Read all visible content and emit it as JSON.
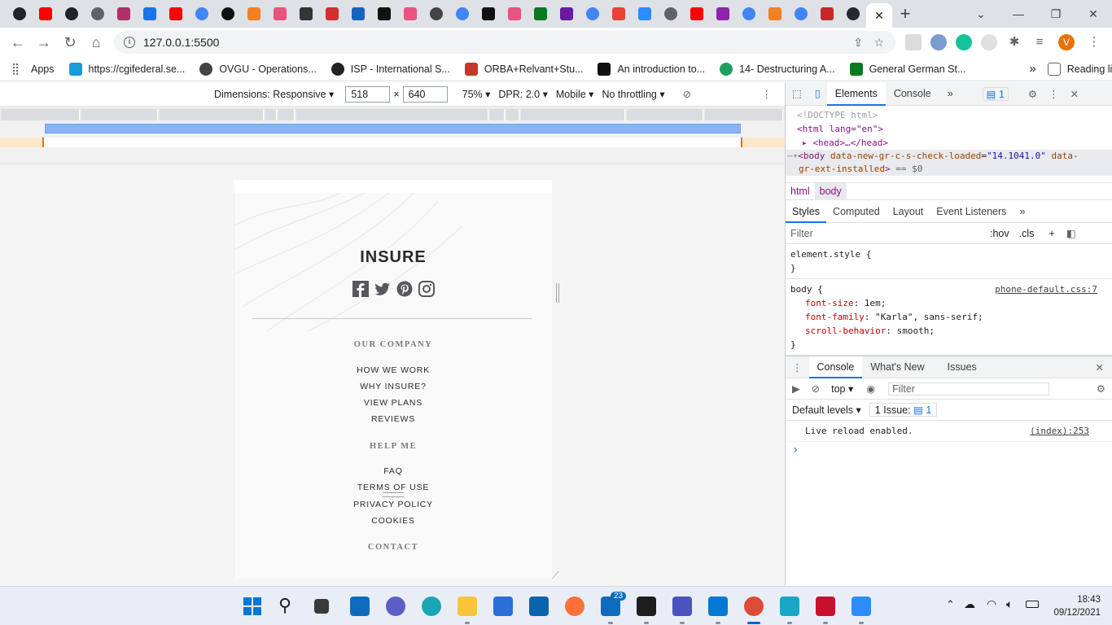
{
  "browser": {
    "url": "127.0.0.1:5500",
    "profile_initial": "V",
    "reading_list": "Reading list"
  },
  "bookmarks": [
    {
      "label": "Apps",
      "color": "#5f6368"
    },
    {
      "label": "https://cgifederal.se...",
      "color": "#1a9bd7"
    },
    {
      "label": "OVGU - Operations...",
      "color": "#444444"
    },
    {
      "label": "ISP - International S...",
      "color": "#222222"
    },
    {
      "label": "ORBA+Relvant+Stu...",
      "color": "#c0392b"
    },
    {
      "label": "An introduction to...",
      "color": "#111111"
    },
    {
      "label": "14- Destructuring A...",
      "color": "#20a060"
    },
    {
      "label": "General German St...",
      "color": "#0a7a20"
    }
  ],
  "devtoolbar": {
    "dimensions": "Dimensions: Responsive",
    "width": "518",
    "times": "×",
    "height": "640",
    "zoom": "75%",
    "dpr": "DPR: 2.0",
    "device_type": "Mobile",
    "throttling": "No throttling"
  },
  "site": {
    "logo": "INSURE",
    "sections": [
      {
        "heading": "OUR COMPANY",
        "links": [
          "HOW WE WORK",
          "WHY INSURE?",
          "VIEW PLANS",
          "REVIEWS"
        ]
      },
      {
        "heading": "HELP ME",
        "links": [
          "FAQ",
          "TERMS OF USE",
          "PRIVACY POLICY",
          "COOKIES"
        ]
      },
      {
        "heading": "CONTACT",
        "links": []
      }
    ]
  },
  "devtools": {
    "tabs": [
      "Elements",
      "Console"
    ],
    "issue_count": "1",
    "dom": {
      "doctype": "<!DOCTYPE html>",
      "html_open": "<html lang=\"en\">",
      "head": "<head>…</head>",
      "body_attr_1_name": "data-new-gr-c-s-check-loaded",
      "body_attr_1_value": "\"14.1041.0\"",
      "body_attr_2_name": "data-gr-ext-installed",
      "body_suffix": "== $0"
    },
    "breadcrumbs": [
      "html",
      "body"
    ],
    "style_tabs": [
      "Styles",
      "Computed",
      "Layout",
      "Event Listeners"
    ],
    "filter_placeholder": "Filter",
    "hov": ":hov",
    "cls": ".cls",
    "element_style": "element.style {",
    "rule_selector": "body {",
    "rule_source": "phone-default.css:7",
    "rule_props": [
      {
        "name": "font-size",
        "value": "1em;"
      },
      {
        "name": "font-family",
        "value": "\"Karla\", sans-serif;"
      },
      {
        "name": "scroll-behavior",
        "value": "smooth;"
      }
    ],
    "close_brace": "}",
    "drawer_tabs": [
      "Console",
      "What's New",
      "Issues"
    ],
    "context": "top",
    "console_filter": "Filter",
    "default_levels": "Default levels",
    "issues_label": "1 Issue:",
    "issues_count": "1",
    "log_message": "Live reload enabled.",
    "log_source": "(index):253",
    "prompt": "›"
  },
  "taskbar": {
    "time": "18:43",
    "date": "09/12/2021",
    "badge": "23"
  }
}
